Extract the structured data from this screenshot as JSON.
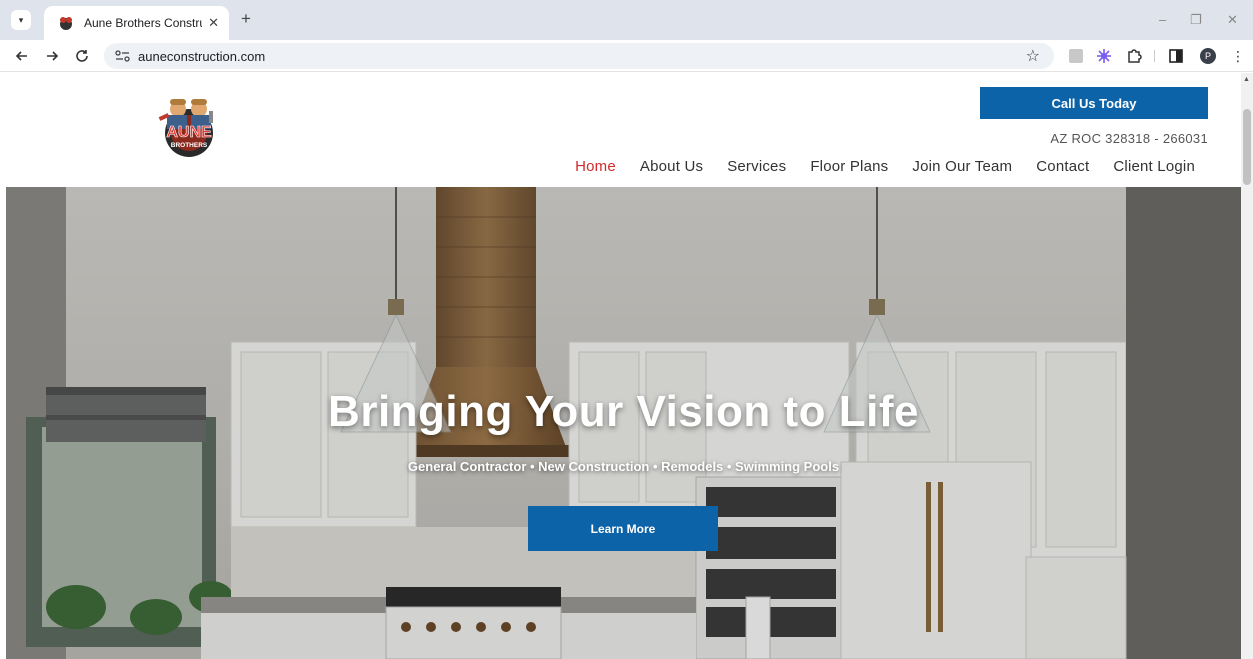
{
  "browser": {
    "tab_title": "Aune Brothers Construction",
    "tab_close": "✕",
    "new_tab": "+",
    "url": "auneconstruction.com",
    "profile_initial": "P",
    "window_controls": {
      "minimize": "–",
      "restore": "❐",
      "close": "✕"
    }
  },
  "header": {
    "logo_text": "AUNE",
    "logo_subtext": "BROTHERS",
    "cta_label": "Call Us Today",
    "license": "AZ ROC 328318 - 266031",
    "nav": [
      {
        "label": "Home",
        "active": true
      },
      {
        "label": "About Us"
      },
      {
        "label": "Services"
      },
      {
        "label": "Floor Plans"
      },
      {
        "label": "Join Our Team"
      },
      {
        "label": "Contact"
      },
      {
        "label": "Client Login"
      }
    ],
    "active_color": "#d22b2b",
    "accent_color": "#0d63a8"
  },
  "hero": {
    "headline": "Bringing Your Vision to Life",
    "subheadline": "General Contractor • New Construction • Remodels • Swimming Pools",
    "button_label": "Learn More"
  }
}
